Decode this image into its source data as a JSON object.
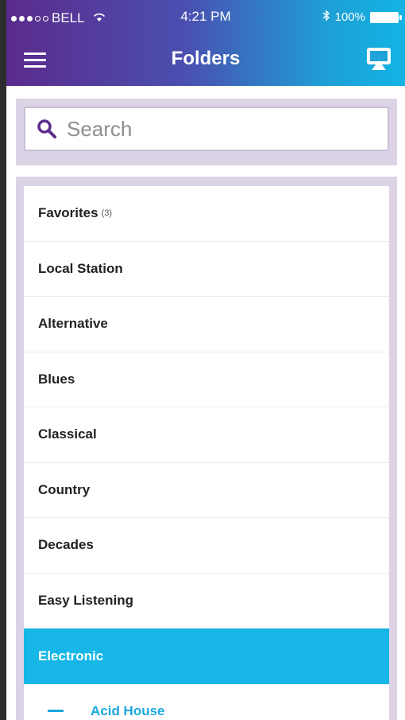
{
  "status_bar": {
    "carrier": "BELL",
    "time": "4:21 PM",
    "battery": "100%"
  },
  "nav": {
    "title": "Folders"
  },
  "search": {
    "placeholder": "Search"
  },
  "folders": [
    {
      "label": "Favorites",
      "count": "(3)"
    },
    {
      "label": "Local Station"
    },
    {
      "label": "Alternative"
    },
    {
      "label": "Blues"
    },
    {
      "label": "Classical"
    },
    {
      "label": "Country"
    },
    {
      "label": "Decades"
    },
    {
      "label": "Easy Listening"
    },
    {
      "label": "Electronic",
      "selected": true
    },
    {
      "label": "Acid House",
      "sub": true
    }
  ],
  "colors": {
    "header_start": "#5b2b8c",
    "header_end": "#13b4e4",
    "selected_row": "#16b7e6",
    "panel_bg": "#dcd3e7",
    "sub_item": "#1aa8de"
  },
  "icons": {
    "menu": "hamburger-menu-icon",
    "airplay": "airplay-icon",
    "search": "search-icon",
    "bluetooth": "bluetooth-icon",
    "wifi": "wifi-icon"
  }
}
